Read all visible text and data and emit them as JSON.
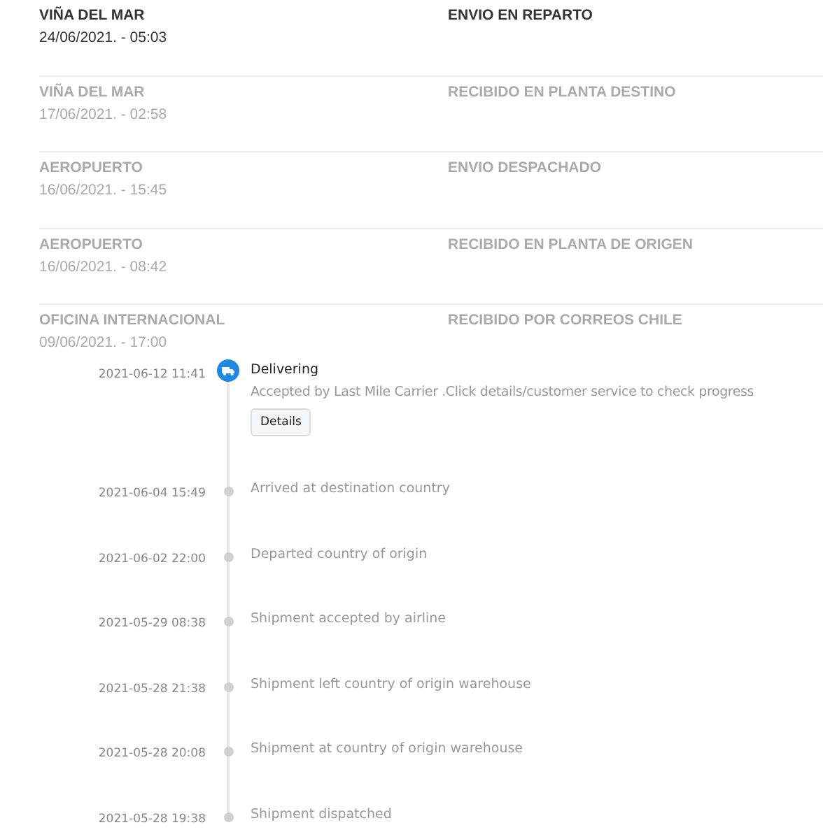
{
  "tracking_rows": [
    {
      "location": "VIÑA DEL MAR",
      "datetime": "24/06/2021. - 05:03",
      "status": "ENVIO EN REPARTO",
      "current": true
    },
    {
      "location": "VIÑA DEL MAR",
      "datetime": "17/06/2021. - 02:58",
      "status": "RECIBIDO EN PLANTA DESTINO",
      "current": false
    },
    {
      "location": "AEROPUERTO",
      "datetime": "16/06/2021. - 15:45",
      "status": "ENVIO DESPACHADO",
      "current": false
    },
    {
      "location": "AEROPUERTO",
      "datetime": "16/06/2021. - 08:42",
      "status": "RECIBIDO EN PLANTA DE ORIGEN",
      "current": false
    },
    {
      "location": "OFICINA INTERNACIONAL",
      "datetime": "09/06/2021. - 17:00",
      "status": "RECIBIDO POR CORREOS CHILE",
      "current": false
    }
  ],
  "timeline": [
    {
      "time": "2021-06-12 11:41",
      "title": "Delivering",
      "description": "Accepted by Last Mile Carrier .Click details/customer service to check progress",
      "button": "Details",
      "current": true
    },
    {
      "time": "2021-06-04 15:49",
      "title": "Arrived at destination country",
      "current": false
    },
    {
      "time": "2021-06-02 22:00",
      "title": "Departed country of origin",
      "current": false
    },
    {
      "time": "2021-05-29 08:38",
      "title": "Shipment accepted by airline",
      "current": false
    },
    {
      "time": "2021-05-28 21:38",
      "title": "Shipment left country of origin warehouse",
      "current": false
    },
    {
      "time": "2021-05-28 20:08",
      "title": "Shipment at country of origin warehouse",
      "current": false
    },
    {
      "time": "2021-05-28 19:38",
      "title": "Shipment dispatched",
      "current": false
    }
  ]
}
